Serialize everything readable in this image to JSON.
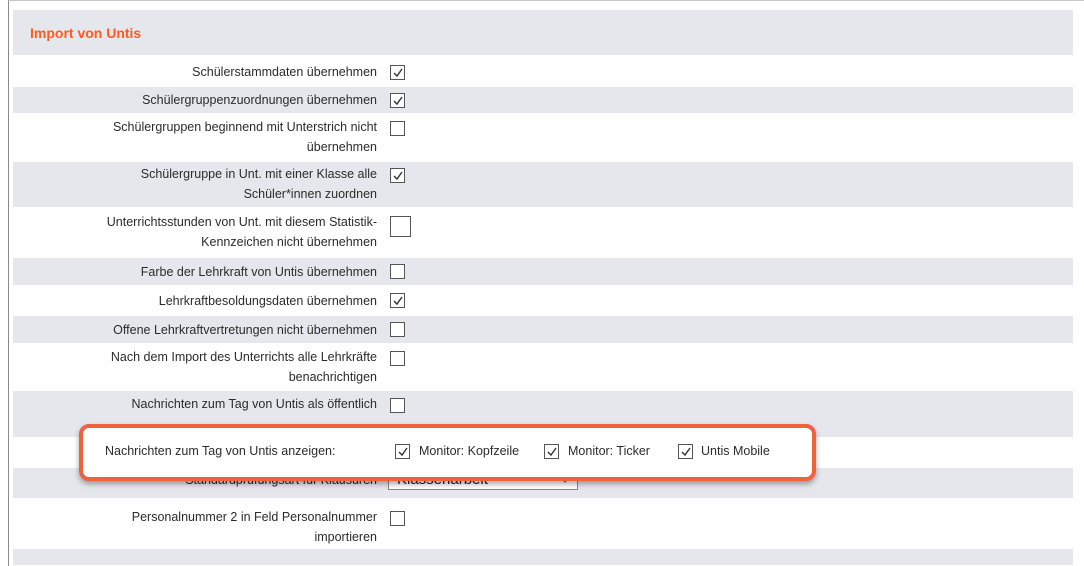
{
  "section": {
    "title": "Import von Untis"
  },
  "rows": [
    {
      "label": "Schülerstammdaten übernehmen",
      "checked": true
    },
    {
      "label": "Schülergruppenzuordnungen übernehmen",
      "checked": true
    },
    {
      "label_line1": "Schülergruppen beginnend mit Unterstrich nicht",
      "label_line2": "übernehmen",
      "checked": false
    },
    {
      "label_line1": "Schülergruppe in Unt. mit einer Klasse alle",
      "label_line2": "Schüler*innen zuordnen",
      "checked": true
    },
    {
      "label_line1": "Unterrichtsstunden von Unt. mit diesem Statistik-",
      "label_line2": "Kennzeichen nicht übernehmen",
      "checked": false
    },
    {
      "label": "Farbe der Lehrkraft von Untis übernehmen",
      "checked": false
    },
    {
      "label": "Lehrkraftbesoldungsdaten übernehmen",
      "checked": true
    },
    {
      "label": "Offene Lehrkraftvertretungen nicht übernehmen",
      "checked": false
    },
    {
      "label_line1": "Nach dem Import des Unterrichts alle Lehrkräfte",
      "label_line2": "benachrichtigen",
      "checked": false
    },
    {
      "label_line1": "Nachrichten zum Tag von Untis als öffentlich",
      "checked": false
    },
    {
      "label": "Standardprüfungsart für Klausuren",
      "select_value": "Klassenarbeit"
    },
    {
      "label_line1": "Personalnummer 2 in Feld Personalnummer",
      "label_line2": "importieren",
      "checked": false
    }
  ],
  "highlight": {
    "label": "Nachrichten zum Tag von Untis anzeigen:",
    "options": [
      {
        "label": "Monitor: Kopfzeile",
        "checked": true
      },
      {
        "label": "Monitor: Ticker",
        "checked": true
      },
      {
        "label": "Untis Mobile",
        "checked": true
      }
    ],
    "border_color": "#f0623a"
  },
  "colors": {
    "accent": "#ff5a1f",
    "row_shade": "#e6e7ec"
  }
}
